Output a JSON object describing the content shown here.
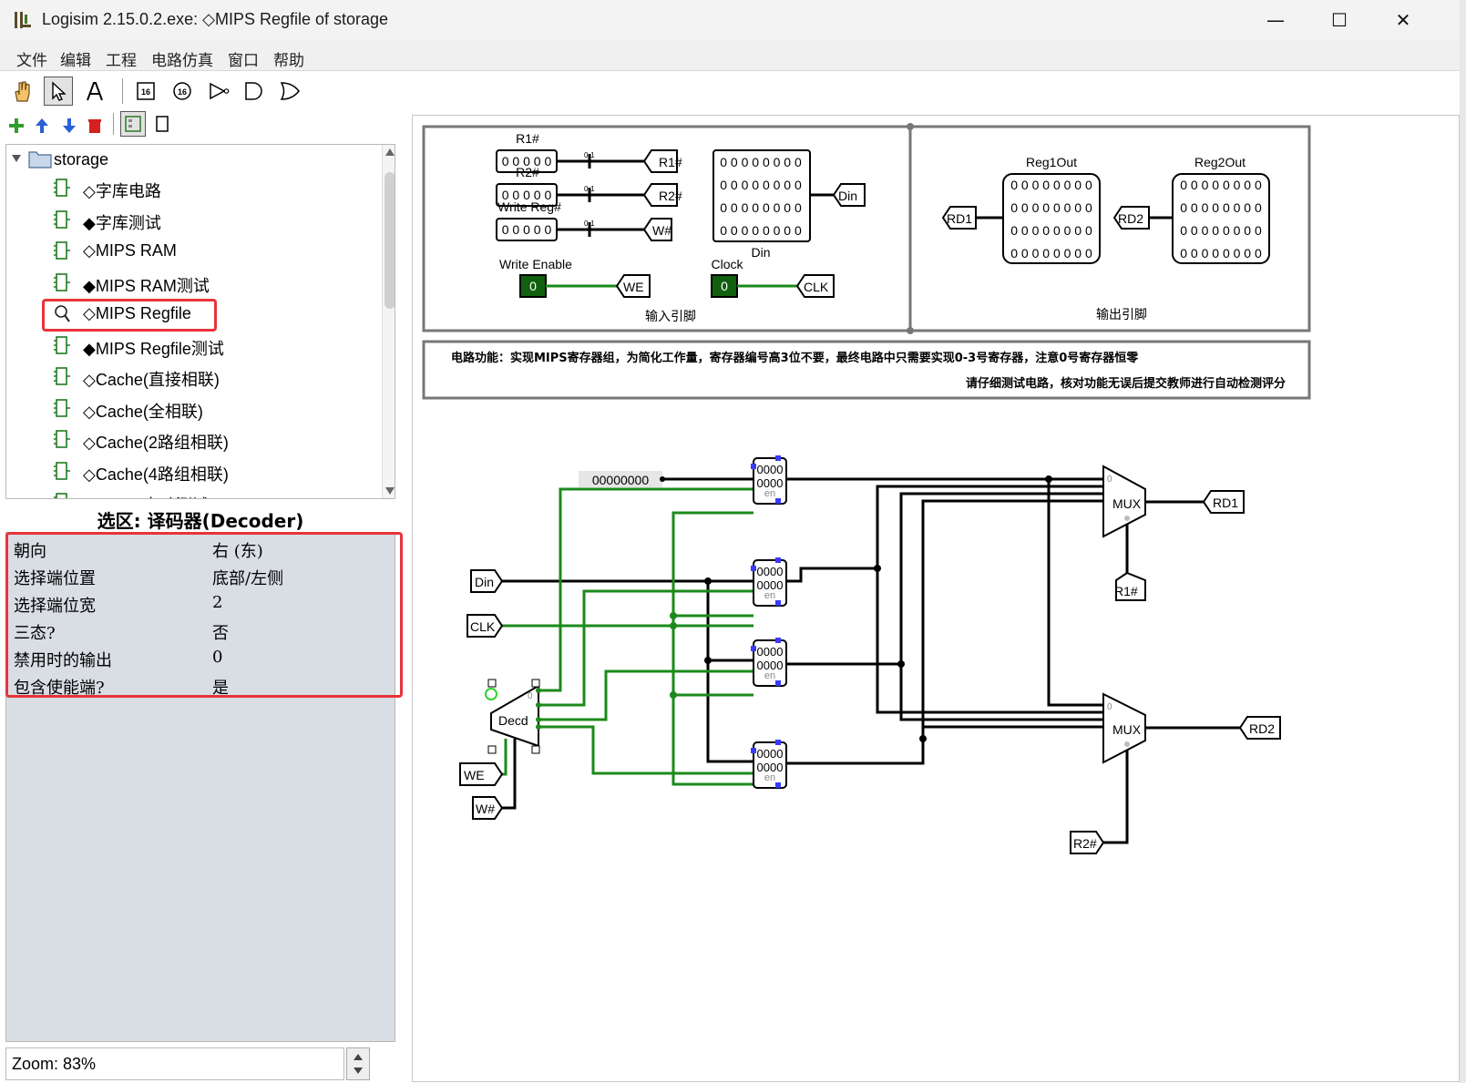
{
  "window": {
    "title": "Logisim 2.15.0.2.exe: ◇MIPS Regfile of storage",
    "controls": {
      "minimize": "—",
      "maximize": "☐",
      "close": "✕"
    }
  },
  "menu": [
    "文件",
    "编辑",
    "工程",
    "电路仿真",
    "窗口",
    "帮助"
  ],
  "toolbar": {
    "tools": [
      "hand-icon",
      "pointer-icon",
      "text-icon",
      "pin-16-icon",
      "probe-16-icon",
      "not-gate-icon",
      "and-gate-icon",
      "or-gate-icon"
    ],
    "selected": "pointer-icon",
    "project_tools": [
      "add-circuit-icon",
      "move-up-icon",
      "move-down-icon",
      "delete-icon",
      "toolbox-view-icon",
      "simulation-view-icon"
    ],
    "pin_label": "16"
  },
  "tree": {
    "root": "storage",
    "items": [
      {
        "label": "◇字库电路"
      },
      {
        "label": "◆字库测试"
      },
      {
        "label": "◇MIPS RAM"
      },
      {
        "label": "◆MIPS RAM测试"
      },
      {
        "label": "◇MIPS Regfile"
      },
      {
        "label": "◆MIPS Regfile测试"
      },
      {
        "label": "◇Cache(直接相联)"
      },
      {
        "label": "◇Cache(全相联)"
      },
      {
        "label": "◇Cache(2路组相联)"
      },
      {
        "label": "◇Cache(4路组相联)"
      },
      {
        "label": "◆Cache自动测试"
      }
    ],
    "selected_index": 4
  },
  "properties": {
    "title": "选区: 译码器(Decoder)",
    "rows": [
      {
        "key": "朝向",
        "value": "右 (东)"
      },
      {
        "key": "选择端位置",
        "value": "底部/左侧"
      },
      {
        "key": "选择端位宽",
        "value": "2"
      },
      {
        "key": "三态?",
        "value": "否"
      },
      {
        "key": "禁用时的输出",
        "value": "0"
      },
      {
        "key": "包含使能端?",
        "value": "是"
      }
    ]
  },
  "zoom": "Zoom: 83%",
  "circuit": {
    "input_box": {
      "title": "输入引脚",
      "r1_label": "R1#",
      "r2_label": "R2#",
      "w_label": "Write Reg#",
      "bits5": "0 0 0 0 0",
      "split_label": "0-1",
      "r1_tunnel": "R1#",
      "r2_tunnel": "R2#",
      "w_tunnel": "W#",
      "we_label": "Write Enable",
      "we_value": "0",
      "we_tunnel": "WE",
      "din_label": "Din",
      "din_bits": "0 0 0 0 0 0 0 0",
      "din_tunnel": "Din",
      "clk_label": "Clock",
      "clk_value": "0",
      "clk_tunnel": "CLK"
    },
    "output_box": {
      "title": "输出引脚",
      "reg1_label": "Reg1Out",
      "reg2_label": "Reg2Out",
      "rd1": "RD1",
      "rd2": "RD2",
      "bits": "0 0 0 0 0 0 0 0"
    },
    "notes": {
      "line1": "电路功能：实现MIPS寄存器组，为简化工作量，寄存器编号高3位不要，最终电路中只需要实现0-3号寄存器，注意0号寄存器恒零",
      "line2": "请仔细测试电路，核对功能无误后提交教师进行自动检测评分"
    },
    "main": {
      "const_value": "00000000",
      "reg_text": "0000",
      "en_text": "en",
      "din": "Din",
      "clk": "CLK",
      "we": "WE",
      "w": "W#",
      "decoder": "Decd",
      "dec_zero": "0",
      "mux": "MUX",
      "mux_zero": "0",
      "rd1": "RD1",
      "rd2": "RD2",
      "r1": "R1#",
      "r2": "R2#"
    }
  }
}
